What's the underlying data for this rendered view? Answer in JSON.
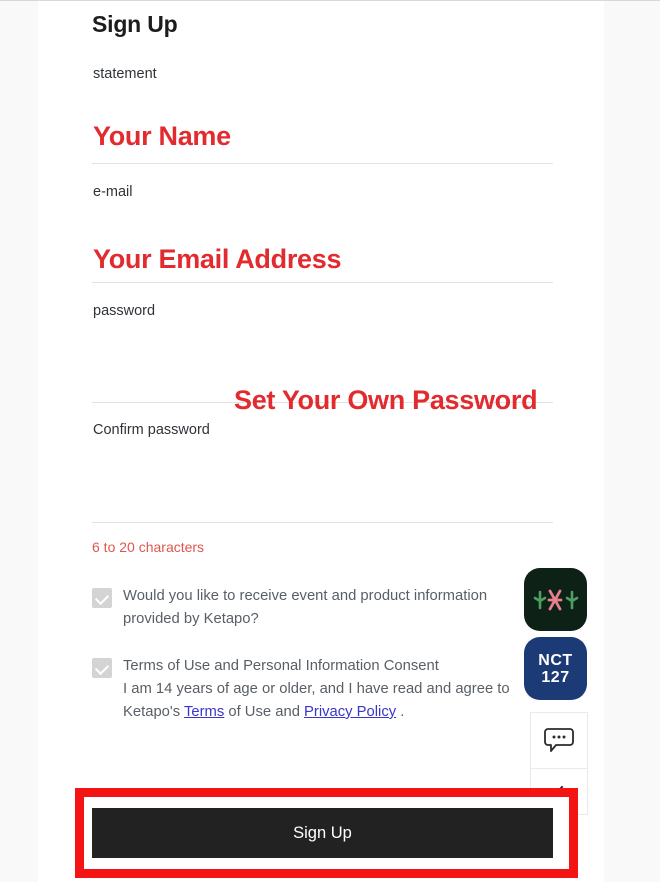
{
  "page": {
    "title": "Sign Up"
  },
  "form": {
    "fields": [
      {
        "label": "statement",
        "name": "statement"
      },
      {
        "label": "e-mail",
        "name": "email"
      },
      {
        "label": "password",
        "name": "password"
      },
      {
        "label": "Confirm password",
        "name": "confirm-password"
      }
    ],
    "password_hint": "6 to 20 characters"
  },
  "annotations": {
    "color": "#e22b2f",
    "name_note": "Your Name",
    "email_note": "Your Email Address",
    "password_note": "Set Your Own Password",
    "highlight_color": "#f51414"
  },
  "agreements": [
    {
      "name": "marketing-consent",
      "checked": true,
      "line1": "Would you like to receive event and product information",
      "line2": "provided by Ketapo?"
    },
    {
      "name": "terms-consent",
      "checked": true,
      "line1": "Terms of Use and Personal Information Consent",
      "line2": "I am 14 years of age or older, and I have read and agree to",
      "line3_prefix": "Ketapo's ",
      "link1": "Terms",
      "line3_middle": " of Use and ",
      "link2": "Privacy Policy",
      "line3_suffix": " ."
    }
  ],
  "widgets": {
    "cactus_badge": {
      "name": "cactus-badge",
      "background": "#0d2116"
    },
    "nct_badge": {
      "name": "nct-127-badge",
      "line1": "NCT",
      "line2": "127",
      "background": "#1c3a75"
    },
    "chat": {
      "name": "chat-bubble"
    },
    "scroll_top": {
      "name": "scroll-to-top"
    }
  },
  "submit": {
    "label": "Sign Up"
  }
}
